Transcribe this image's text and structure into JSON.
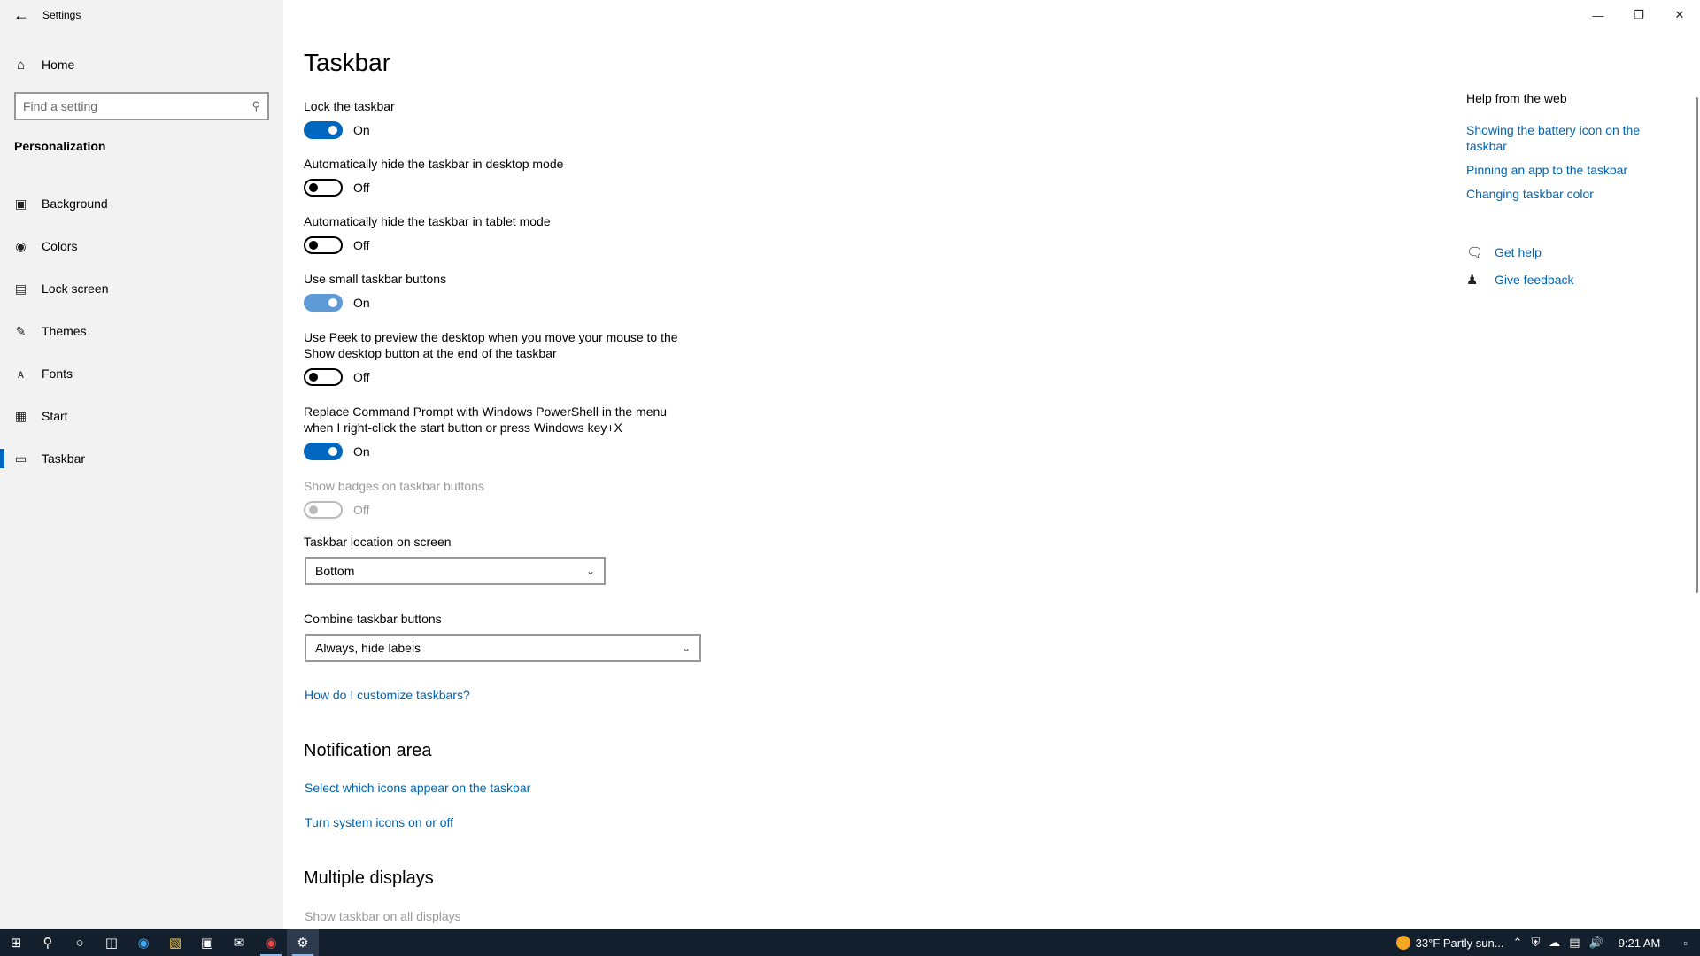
{
  "window": {
    "title": "Settings"
  },
  "sidebar": {
    "home_label": "Home",
    "search_placeholder": "Find a setting",
    "section_title": "Personalization",
    "items": [
      {
        "label": "Background",
        "icon": "image-icon"
      },
      {
        "label": "Colors",
        "icon": "palette-icon"
      },
      {
        "label": "Lock screen",
        "icon": "lock-screen-icon"
      },
      {
        "label": "Themes",
        "icon": "brush-icon"
      },
      {
        "label": "Fonts",
        "icon": "font-icon"
      },
      {
        "label": "Start",
        "icon": "start-icon"
      },
      {
        "label": "Taskbar",
        "icon": "taskbar-icon",
        "active": true
      }
    ]
  },
  "main": {
    "title": "Taskbar",
    "settings": [
      {
        "label": "Lock the taskbar",
        "state": "On"
      },
      {
        "label": "Automatically hide the taskbar in desktop mode",
        "state": "Off"
      },
      {
        "label": "Automatically hide the taskbar in tablet mode",
        "state": "Off"
      },
      {
        "label": "Use small taskbar buttons",
        "state": "On"
      },
      {
        "label": "Use Peek to preview the desktop when you move your mouse to the Show desktop button at the end of the taskbar",
        "state": "Off"
      },
      {
        "label": "Replace Command Prompt with Windows PowerShell in the menu when I right-click the start button or press Windows key+X",
        "state": "On"
      },
      {
        "label": "Show badges on taskbar buttons",
        "state": "Off",
        "disabled": true
      }
    ],
    "location_label": "Taskbar location on screen",
    "location_value": "Bottom",
    "combine_label": "Combine taskbar buttons",
    "combine_value": "Always, hide labels",
    "customize_link": "How do I customize taskbars?",
    "notification_heading": "Notification area",
    "notification_links": [
      "Select which icons appear on the taskbar",
      "Turn system icons on or off"
    ],
    "multiple_displays_heading": "Multiple displays",
    "multiple_displays_first": "Show taskbar on all displays"
  },
  "help": {
    "title": "Help from the web",
    "links": [
      "Showing the battery icon on the taskbar",
      "Pinning an app to the taskbar",
      "Changing taskbar color"
    ],
    "get_help": "Get help",
    "give_feedback": "Give feedback"
  },
  "taskbar": {
    "weather": "33°F  Partly sun...",
    "time": "9:21 AM",
    "accent": "#0067c0"
  }
}
